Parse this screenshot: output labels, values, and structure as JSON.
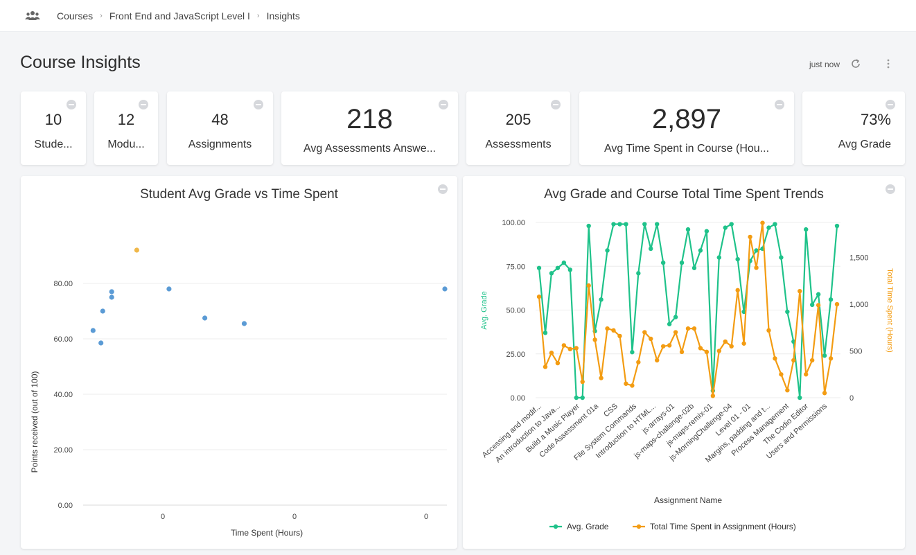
{
  "breadcrumb": {
    "icon": "users-icon",
    "items": [
      "Courses",
      "Front End and JavaScript Level I",
      "Insights"
    ],
    "separator": "›"
  },
  "header": {
    "title": "Course Insights",
    "updated": "just now",
    "refresh_icon": "refresh-icon",
    "menu_icon": "more-vertical-icon"
  },
  "kpis": [
    {
      "value": "10",
      "label": "Stude..."
    },
    {
      "value": "12",
      "label": "Modu..."
    },
    {
      "value": "48",
      "label": "Assignments"
    },
    {
      "value": "218",
      "label": "Avg Assessments Answe..."
    },
    {
      "value": "205",
      "label": "Assessments"
    },
    {
      "value": "2,897",
      "label": "Avg Time Spent in Course (Hou..."
    },
    {
      "value": "73%",
      "label": "Avg Grade"
    }
  ],
  "colors": {
    "scatter_point": "#5b9bd5",
    "scatter_highlight": "#f0b84a",
    "grade_line": "#1fc28a",
    "time_line": "#f39c12",
    "grid": "#ececec"
  },
  "chart_data": [
    {
      "type": "scatter",
      "title": "Student Avg Grade vs Time Spent",
      "xlabel": "Time Spent (Hours)",
      "ylabel": "Points received (out of 100)",
      "ylim": [
        0,
        100
      ],
      "yticks": [
        "0.00",
        "20.00",
        "40.00",
        "60.00",
        "80.00"
      ],
      "xticks": [
        "0",
        "0",
        "0"
      ],
      "grid": true,
      "points": [
        {
          "x": 0.018,
          "y": 63,
          "highlight": false
        },
        {
          "x": 0.04,
          "y": 58.5,
          "highlight": false
        },
        {
          "x": 0.045,
          "y": 70,
          "highlight": false
        },
        {
          "x": 0.07,
          "y": 77,
          "highlight": false
        },
        {
          "x": 0.07,
          "y": 75,
          "highlight": false
        },
        {
          "x": 0.14,
          "y": 92,
          "highlight": true
        },
        {
          "x": 0.23,
          "y": 78,
          "highlight": false
        },
        {
          "x": 0.33,
          "y": 67.5,
          "highlight": false
        },
        {
          "x": 0.44,
          "y": 65.5,
          "highlight": false
        },
        {
          "x": 1.0,
          "y": 78,
          "highlight": false
        }
      ]
    },
    {
      "type": "line",
      "title": "Avg Grade and Course Total Time Spent Trends",
      "xlabel": "Assignment Name",
      "ylabel_left": "Avg. Grade",
      "ylabel_right": "Total Time Spent (Hours)",
      "ylim_left": [
        0,
        100
      ],
      "ylim_right": [
        0,
        1875
      ],
      "yticks_left": [
        "0.00",
        "25.00",
        "50.00",
        "75.00",
        "100.00"
      ],
      "yticks_right": [
        "0",
        "500",
        "1,000",
        "1,500"
      ],
      "categories": [
        "Accessing and modif...",
        "An introduction to Java...",
        "Build a Music Player",
        "Code Assessment 01a",
        "CSS",
        "File System Commands",
        "Introduction to HTML...",
        "js-arrays-01",
        "js-maps-challenge-02b",
        "js-maps-remix-01",
        "js-MorningChallenge-04",
        "Level 01 - 01",
        "Margins, padding and t...",
        "Process Management",
        "The Codio Editor",
        "Users and Permissions"
      ],
      "legend_position": "bottom",
      "series": [
        {
          "name": "Avg. Grade",
          "axis": "left",
          "values": [
            74,
            37,
            71,
            74,
            77,
            73,
            0,
            0,
            98,
            38,
            56,
            84,
            99,
            99,
            99,
            26,
            71,
            99,
            85,
            99,
            77,
            42,
            46,
            77,
            96,
            74,
            84,
            95,
            4,
            80,
            97,
            99,
            79,
            49,
            78,
            84,
            85,
            97,
            99,
            80,
            49,
            32,
            0,
            96,
            53,
            59,
            24,
            56,
            98
          ]
        },
        {
          "name": "Total Time Spent in Assignment (Hours)",
          "axis": "right",
          "values": [
            1080,
            330,
            480,
            370,
            560,
            520,
            530,
            170,
            1200,
            620,
            210,
            740,
            720,
            660,
            150,
            130,
            380,
            700,
            630,
            400,
            550,
            560,
            700,
            490,
            740,
            740,
            530,
            490,
            20,
            500,
            600,
            550,
            1150,
            580,
            1720,
            1390,
            1870,
            720,
            420,
            250,
            80,
            400,
            1140,
            250,
            400,
            990,
            50,
            420,
            1000
          ]
        }
      ]
    }
  ]
}
